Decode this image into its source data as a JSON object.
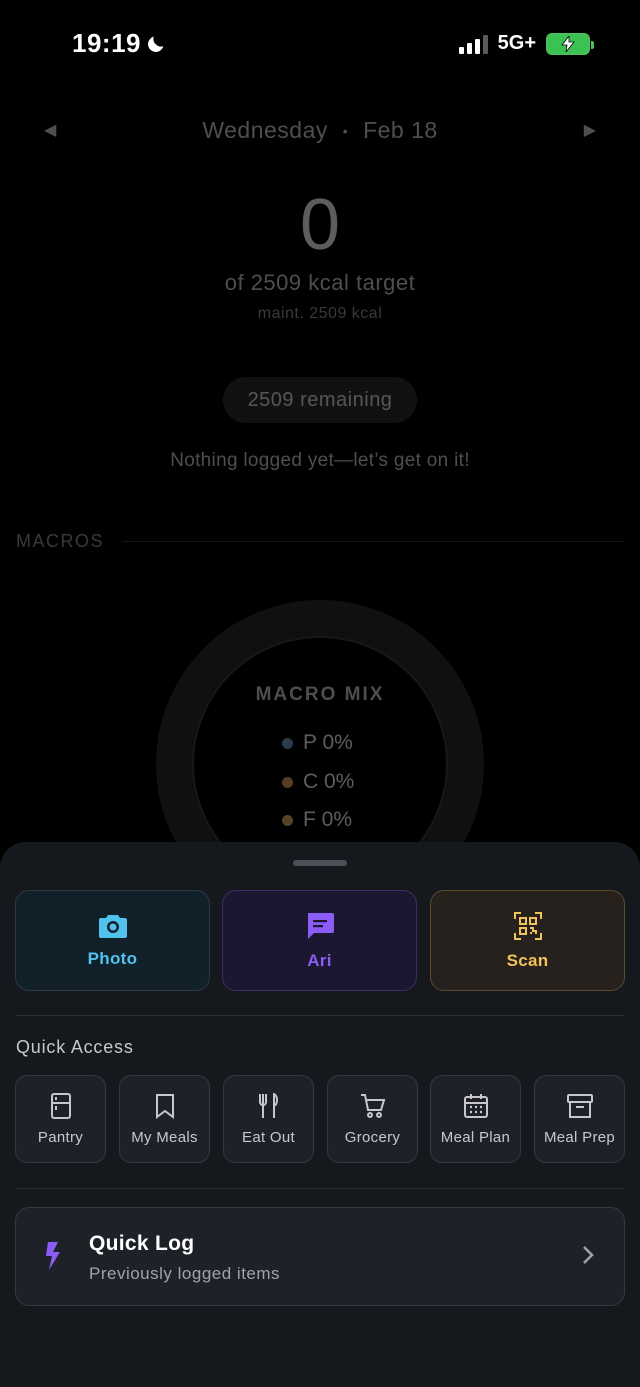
{
  "status_bar": {
    "time": "19:19",
    "network": "5G+"
  },
  "day_view": {
    "weekday": "Wednesday",
    "separator": "•",
    "date": "Feb 18",
    "kcal_consumed": "0",
    "target_text": "of 2509 kcal target",
    "maintenance_text": "maint. 2509 kcal",
    "remaining_text": "2509 remaining",
    "empty_message": "Nothing logged yet—let’s get on it!",
    "macros_section_label": "MACROS",
    "macro_mix_title": "MACRO MIX",
    "macros": [
      {
        "label": "P 0%",
        "color": "#6b8fb0"
      },
      {
        "label": "C 0%",
        "color": "#c8955a"
      },
      {
        "label": "F 0%",
        "color": "#c9a25a"
      }
    ]
  },
  "actions": [
    {
      "label": "Photo",
      "icon": "camera-icon",
      "color": "#4fc3ee"
    },
    {
      "label": "Ari",
      "icon": "chat-icon",
      "color": "#8b5cf6"
    },
    {
      "label": "Scan",
      "icon": "qr-scan-icon",
      "color": "#f2c35b"
    }
  ],
  "quick_access": {
    "title": "Quick Access",
    "items": [
      {
        "label": "Pantry",
        "icon": "fridge-icon"
      },
      {
        "label": "My Meals",
        "icon": "bookmark-icon"
      },
      {
        "label": "Eat Out",
        "icon": "utensils-icon"
      },
      {
        "label": "Grocery",
        "icon": "cart-icon"
      },
      {
        "label": "Meal Plan",
        "icon": "calendar-icon"
      },
      {
        "label": "Meal Prep",
        "icon": "archive-box-icon"
      }
    ]
  },
  "quick_log": {
    "title": "Quick Log",
    "subtitle": "Previously logged items",
    "icon": "lightning-icon",
    "accent": "#8b5cf6"
  }
}
